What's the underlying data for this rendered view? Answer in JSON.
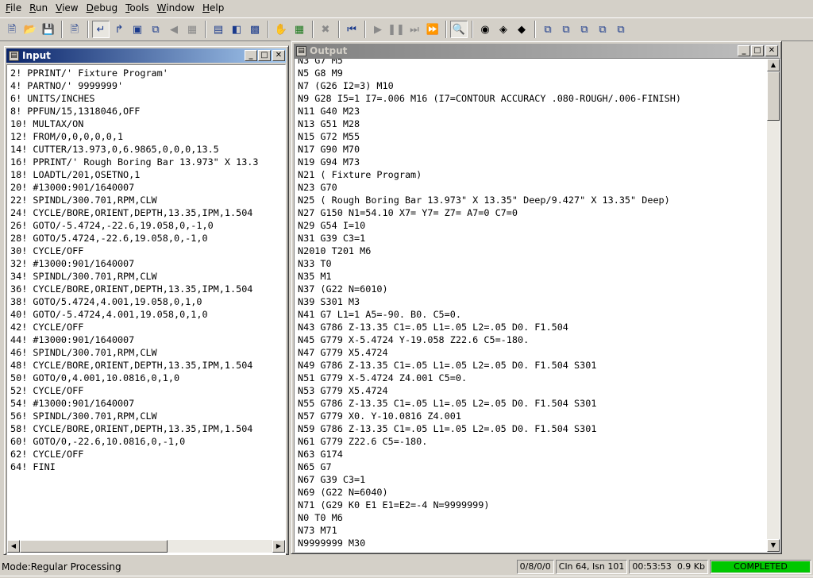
{
  "menubar": {
    "items": [
      {
        "label": "File"
      },
      {
        "label": "Run"
      },
      {
        "label": "View"
      },
      {
        "label": "Debug"
      },
      {
        "label": "Tools"
      },
      {
        "label": "Window"
      },
      {
        "label": "Help"
      }
    ]
  },
  "toolbar": {
    "icons": [
      "new-file-icon",
      "open-folder-icon",
      "save-icon",
      "print-preview-icon",
      "step-into-icon",
      "step-out-icon",
      "window-icon",
      "export-icon",
      "back-gray-icon",
      "grid-gray-icon",
      "list-icon",
      "image-icon",
      "image-edit-icon",
      "hand-icon",
      "tree-icon",
      "cancel-gray-icon",
      "rewind-icon",
      "play-icon",
      "pause-icon",
      "step-forward-icon",
      "fast-forward-icon",
      "find-icon",
      "binoculars-icon",
      "find-next-icon",
      "find-prev-icon",
      "cascade-1-icon",
      "cascade-2-icon",
      "cascade-3-icon",
      "cascade-4-icon",
      "cascade-5-icon"
    ]
  },
  "input_window": {
    "title": "Input",
    "lines": [
      "2! PPRINT/' Fixture Program'",
      "4! PARTNO/' 9999999'",
      "6! UNITS/INCHES",
      "8! PPFUN/15,1318046,OFF",
      "10! MULTAX/ON",
      "12! FROM/0,0,0,0,0,1",
      "14! CUTTER/13.973,0,6.9865,0,0,0,13.5",
      "16! PPRINT/' Rough Boring Bar 13.973\" X 13.3",
      "18! LOADTL/201,OSETNO,1",
      "20! #13000:901/1640007",
      "22! SPINDL/300.701,RPM,CLW",
      "24! CYCLE/BORE,ORIENT,DEPTH,13.35,IPM,1.504",
      "26! GOTO/-5.4724,-22.6,19.058,0,-1,0",
      "28! GOTO/5.4724,-22.6,19.058,0,-1,0",
      "30! CYCLE/OFF",
      "32! #13000:901/1640007",
      "34! SPINDL/300.701,RPM,CLW",
      "36! CYCLE/BORE,ORIENT,DEPTH,13.35,IPM,1.504",
      "38! GOTO/5.4724,4.001,19.058,0,1,0",
      "40! GOTO/-5.4724,4.001,19.058,0,1,0",
      "42! CYCLE/OFF",
      "44! #13000:901/1640007",
      "46! SPINDL/300.701,RPM,CLW",
      "48! CYCLE/BORE,ORIENT,DEPTH,13.35,IPM,1.504",
      "50! GOTO/0,4.001,10.0816,0,1,0",
      "52! CYCLE/OFF",
      "54! #13000:901/1640007",
      "56! SPINDL/300.701,RPM,CLW",
      "58! CYCLE/BORE,ORIENT,DEPTH,13.35,IPM,1.504",
      "60! GOTO/0,-22.6,10.0816,0,-1,0",
      "62! CYCLE/OFF",
      "64! FINI"
    ]
  },
  "output_window": {
    "title": "Output",
    "lines": [
      "N3 G7 M5",
      "N5 G8 M9",
      "N7 (G26 I2=3) M10",
      "N9 G28 I5=1 I7=.006 M16 (I7=CONTOUR ACCURACY .080-ROUGH/.006-FINISH)",
      "N11 G40 M23",
      "N13 G51 M28",
      "N15 G72 M55",
      "N17 G90 M70",
      "N19 G94 M73",
      "N21 ( Fixture Program)",
      "N23 G70",
      "N25 ( Rough Boring Bar 13.973\" X 13.35\" Deep/9.427\" X 13.35\" Deep)",
      "N27 G150 N1=54.10 X7= Y7= Z7= A7=0 C7=0",
      "N29 G54 I=10",
      "N31 G39 C3=1",
      "N2010 T201 M6",
      "N33 T0",
      "N35 M1",
      "N37 (G22 N=6010)",
      "N39 S301 M3",
      "N41 G7 L1=1 A5=-90. B0. C5=0.",
      "N43 G786 Z-13.35 C1=.05 L1=.05 L2=.05 D0. F1.504",
      "N45 G779 X-5.4724 Y-19.058 Z22.6 C5=-180.",
      "N47 G779 X5.4724",
      "N49 G786 Z-13.35 C1=.05 L1=.05 L2=.05 D0. F1.504 S301",
      "N51 G779 X-5.4724 Z4.001 C5=0.",
      "N53 G779 X5.4724",
      "N55 G786 Z-13.35 C1=.05 L1=.05 L2=.05 D0. F1.504 S301",
      "N57 G779 X0. Y-10.0816 Z4.001",
      "N59 G786 Z-13.35 C1=.05 L1=.05 L2=.05 D0. F1.504 S301",
      "N61 G779 Z22.6 C5=-180.",
      "N63 G174",
      "N65 G7",
      "N67 G39 C3=1",
      "N69 (G22 N=6040)",
      "N71 (G29 K0 E1 E1=E2=-4 N=9999999)",
      "N0 T0 M6",
      "N73 M71",
      "N9999999 M30"
    ]
  },
  "statusbar": {
    "mode": "Mode:Regular Processing",
    "counts": "0/8/0/0",
    "position": "Cln 64, Isn 101",
    "time": "00:53:53",
    "size": "0.9 Kb",
    "progress_label": "COMPLETED",
    "progress_fraction": 1.0,
    "progress_color": "#00c800"
  },
  "colors": {
    "active_title": "#0a246a",
    "inactive_title": "#808080",
    "face": "#d4d0c8"
  }
}
